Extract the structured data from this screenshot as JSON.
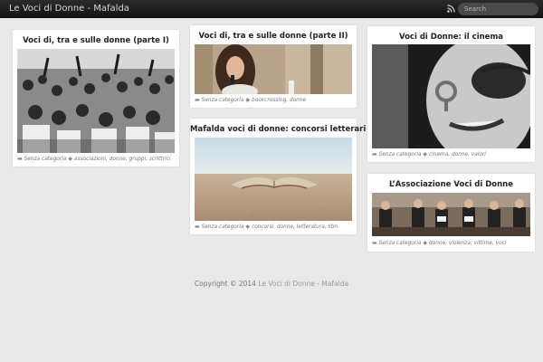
{
  "header": {
    "site_title": "Le Voci di Donne - Mafalda",
    "rss_icon": "rss-icon",
    "search_placeholder": "Search"
  },
  "posts": [
    {
      "title": "Voci di, tra e sulle donne (parte I)",
      "category": "Senza categoria",
      "tags": "associazioni, donne, gruppi, scrittrici",
      "image": "black-and-white crowd of women protesting"
    },
    {
      "title": "Voci di, tra e sulle donne (parte II)",
      "category": "Senza categoria",
      "tags": "bookcrossing, donne",
      "image": "woman singing into microphone"
    },
    {
      "title": "Mafalda voci di donne: concorsi letterari",
      "category": "Senza categoria",
      "tags": "concorsi, donne, letteratura, libri",
      "image": "open book on a sandy beach"
    },
    {
      "title": "Voci di Donne: il cinema",
      "category": "Senza categoria",
      "tags": "cinema, donne, valori",
      "image": "smiling woman with symbol painted on cheek"
    },
    {
      "title": "L’Associazione Voci di Donne",
      "category": "Senza categoria",
      "tags": "donne, violenza, vittime, voci",
      "image": "women seated at a reading event"
    }
  ],
  "footer": {
    "prefix": "Copyright © 2014",
    "site_link": "Le Voci di Donne - Mafalda"
  },
  "colors": {
    "background": "#e9e9e9",
    "topbar": "#1a1a1a",
    "card": "#ffffff",
    "meta_text": "#888888"
  }
}
